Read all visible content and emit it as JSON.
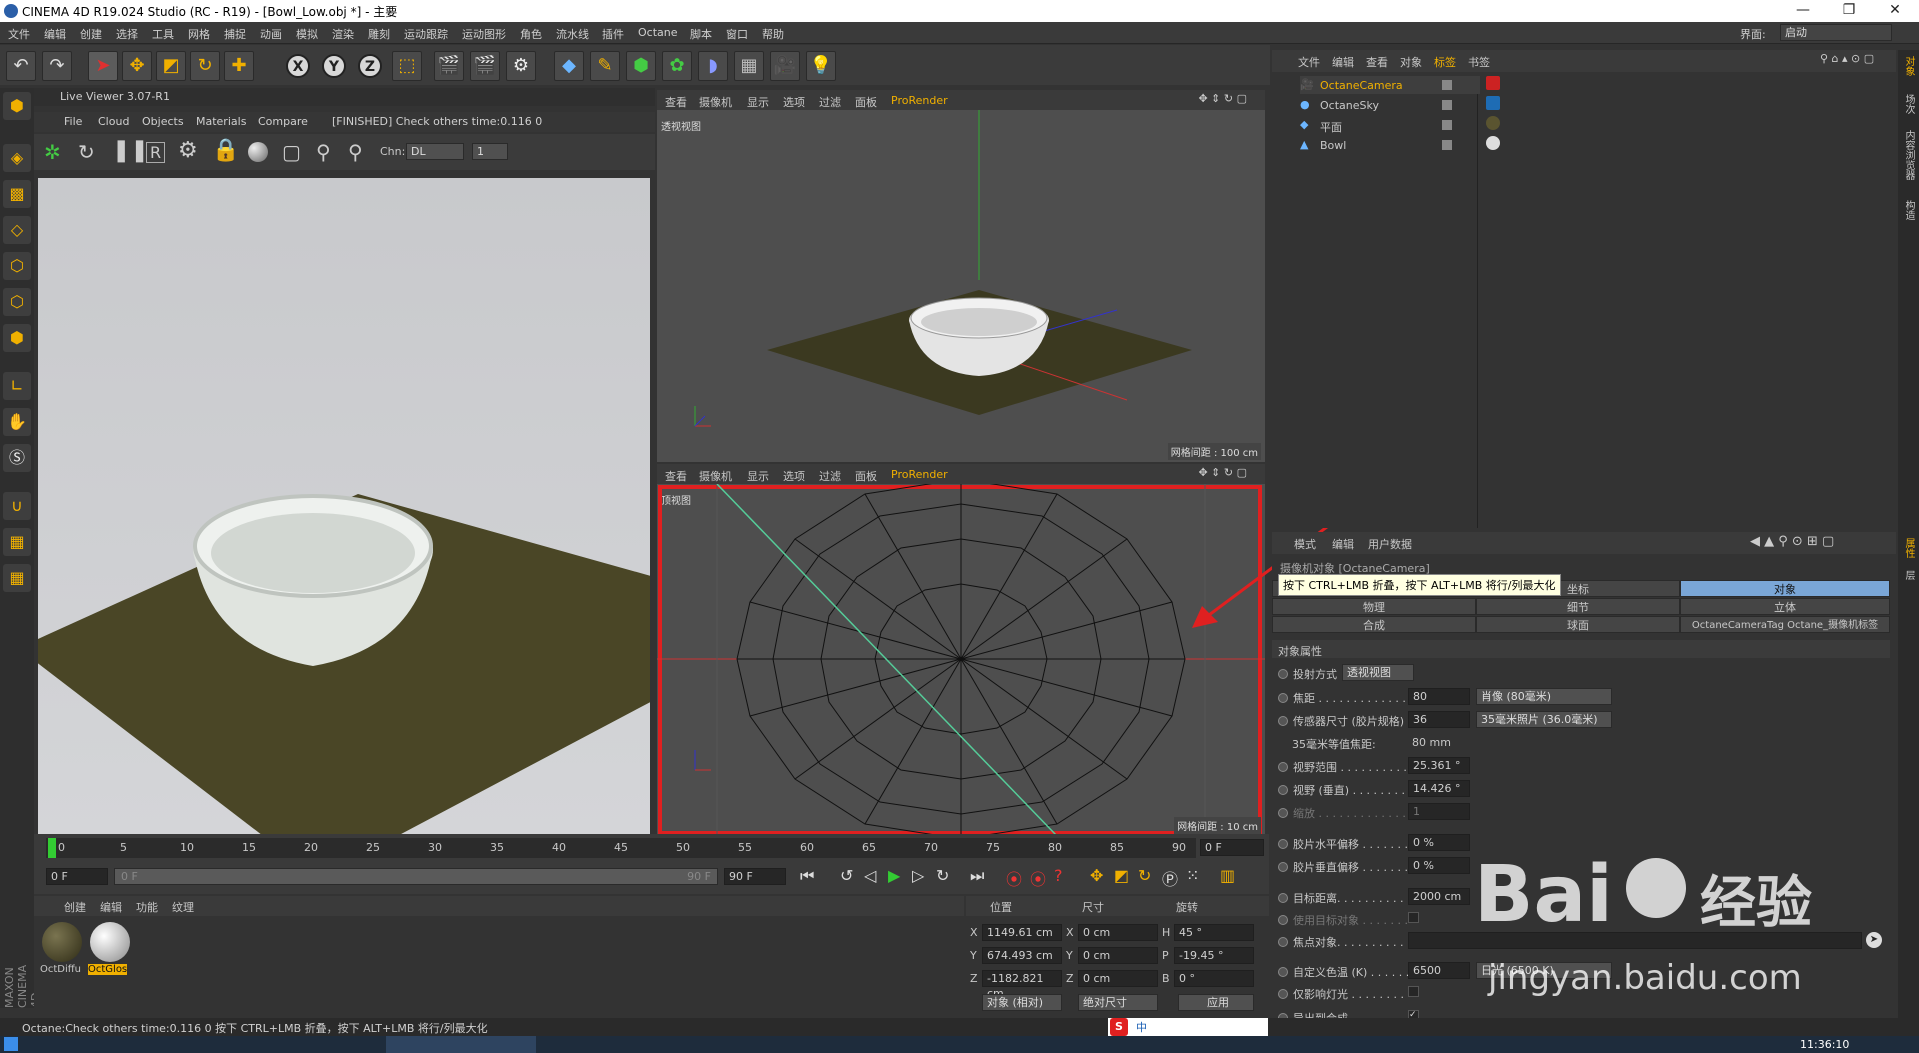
{
  "window": {
    "title": "CINEMA 4D R19.024 Studio (RC - R19) - [Bowl_Low.obj *] - 主要",
    "minimize": "—",
    "restore": "❐",
    "close": "✕"
  },
  "menubar": {
    "items": [
      "文件",
      "编辑",
      "创建",
      "选择",
      "工具",
      "网格",
      "捕捉",
      "动画",
      "模拟",
      "渲染",
      "雕刻",
      "运动跟踪",
      "运动图形",
      "角色",
      "流水线",
      "插件",
      "Octane",
      "脚本",
      "窗口",
      "帮助"
    ],
    "layout_label": "界面:",
    "layout_value": "启动"
  },
  "toolbar": {
    "undo": "↶",
    "redo": "↷",
    "x": "X",
    "y": "Y",
    "z": "Z"
  },
  "live_viewer": {
    "title": "Live Viewer 3.07-R1",
    "menu": [
      "File",
      "Cloud",
      "Objects",
      "Materials",
      "Compare"
    ],
    "status": "[FINISHED] Check others time:0.116  0",
    "chn_label": "Chn:",
    "chn_value": "DL",
    "chn_num": "1"
  },
  "viewport_top": {
    "menu": [
      "查看",
      "摄像机",
      "显示",
      "选项",
      "过滤",
      "面板",
      "ProRender"
    ],
    "name": "透视视图",
    "grid": "网格间距 : 100 cm"
  },
  "viewport_bottom": {
    "menu": [
      "查看",
      "摄像机",
      "显示",
      "选项",
      "过滤",
      "面板",
      "ProRender"
    ],
    "name": "顶视图",
    "grid": "网格间距 : 10 cm"
  },
  "object_manager": {
    "menu": [
      "文件",
      "编辑",
      "查看",
      "对象",
      "标签",
      "书签"
    ],
    "objects": [
      {
        "name": "OctaneCamera",
        "active": true
      },
      {
        "name": "OctaneSky",
        "active": false
      },
      {
        "name": "平面",
        "active": false
      },
      {
        "name": "Bowl",
        "active": false
      }
    ]
  },
  "right_tabs": [
    "对象",
    "场次",
    "内容浏览器",
    "构造"
  ],
  "right_tabs_lower": [
    "属性",
    "层"
  ],
  "attribute_manager": {
    "menu": [
      "模式",
      "编辑",
      "用户数据"
    ],
    "object_title": "摄像机对象 [OctaneCamera]",
    "tooltip": "按下 CTRL+LMB 折叠，按下 ALT+LMB 将行/列最大化",
    "tabs_row1": [
      "基本",
      "坐标",
      "对象"
    ],
    "tabs_row2": [
      "物理",
      "细节",
      "立体"
    ],
    "tabs_row3": [
      "合成",
      "球面",
      "OctaneCameraTag Octane_摄像机标签"
    ],
    "section": "对象属性",
    "projection_label": "投射方式",
    "projection_value": "透视视图",
    "rows": [
      {
        "label": "焦距 . . . . . . . . . . . . .",
        "value": "80",
        "extra": "肖像 (80毫米)"
      },
      {
        "label": "传感器尺寸 (胶片规格)",
        "value": "36",
        "extra": "35毫米照片 (36.0毫米)"
      },
      {
        "label": "35毫米等值焦距:",
        "value": "80 mm",
        "extra": ""
      },
      {
        "label": "视野范围 . . . . . . . . . .",
        "value": "25.361 °",
        "extra": ""
      },
      {
        "label": "视野 (垂直) . . . . . . . .",
        "value": "14.426 °",
        "extra": ""
      },
      {
        "label": "缩放 . . . . . . . . . . . . .",
        "value": "1",
        "extra": ""
      },
      {
        "label": "胶片水平偏移 . . . . . . .",
        "value": "0 %",
        "extra": ""
      },
      {
        "label": "胶片垂直偏移 . . . . . . .",
        "value": "0 %",
        "extra": ""
      },
      {
        "label": "目标距离. . . . . . . . . . .",
        "value": "2000 cm",
        "extra": ""
      },
      {
        "label": "使用目标对象 . . . . . . .",
        "value": "",
        "extra": ""
      },
      {
        "label": "焦点对象. . . . . . . . . . .",
        "value": "",
        "extra": ""
      },
      {
        "label": "自定义色温 (K) . . . . . .",
        "value": "6500",
        "extra": "日光 (6500 K)"
      },
      {
        "label": "仅影响灯光 . . . . . . . .",
        "value": "",
        "extra": ""
      },
      {
        "label": "导出到合成 . . . . . . . .",
        "value": "",
        "extra": ""
      }
    ]
  },
  "timeline": {
    "ticks": [
      "0",
      "5",
      "10",
      "15",
      "20",
      "25",
      "30",
      "35",
      "40",
      "45",
      "50",
      "55",
      "60",
      "65",
      "70",
      "75",
      "80",
      "85",
      "90"
    ],
    "current": "0 F",
    "start": "0 F",
    "range_start": "0 F",
    "range_end": "90 F",
    "end": "90 F"
  },
  "material_manager": {
    "menu": [
      "创建",
      "编辑",
      "功能",
      "纹理"
    ],
    "materials": [
      {
        "name": "OctDiffu",
        "selected": false
      },
      {
        "name": "OctGlos",
        "selected": true
      }
    ]
  },
  "coordinates": {
    "headers": [
      "位置",
      "尺寸",
      "旋转"
    ],
    "rows": [
      {
        "axis": "X",
        "pos": "1149.61 cm",
        "size_axis": "X",
        "size": "0 cm",
        "rot_axis": "H",
        "rot": "45 °"
      },
      {
        "axis": "Y",
        "pos": "674.493 cm",
        "size_axis": "Y",
        "size": "0 cm",
        "rot_axis": "P",
        "rot": "-19.45 °"
      },
      {
        "axis": "Z",
        "pos": "-1182.821 cm",
        "size_axis": "Z",
        "size": "0 cm",
        "rot_axis": "B",
        "rot": "0 °"
      }
    ],
    "mode1": "对象 (相对)",
    "mode2": "绝对尺寸",
    "apply": "应用"
  },
  "statusbar": {
    "text": "Octane:Check others time:0.116  0    按下 CTRL+LMB 折叠，按下 ALT+LMB 将行/列最大化"
  },
  "taskbar": {
    "time": "11:36:10",
    "ime": "中"
  },
  "watermark": {
    "brand": "Bai",
    "brand2": "经验",
    "url": "jingyan.baidu.com"
  },
  "colors": {
    "accent": "#f0b000",
    "highlight_red": "#e02020",
    "selection": "#7aa6d6"
  }
}
